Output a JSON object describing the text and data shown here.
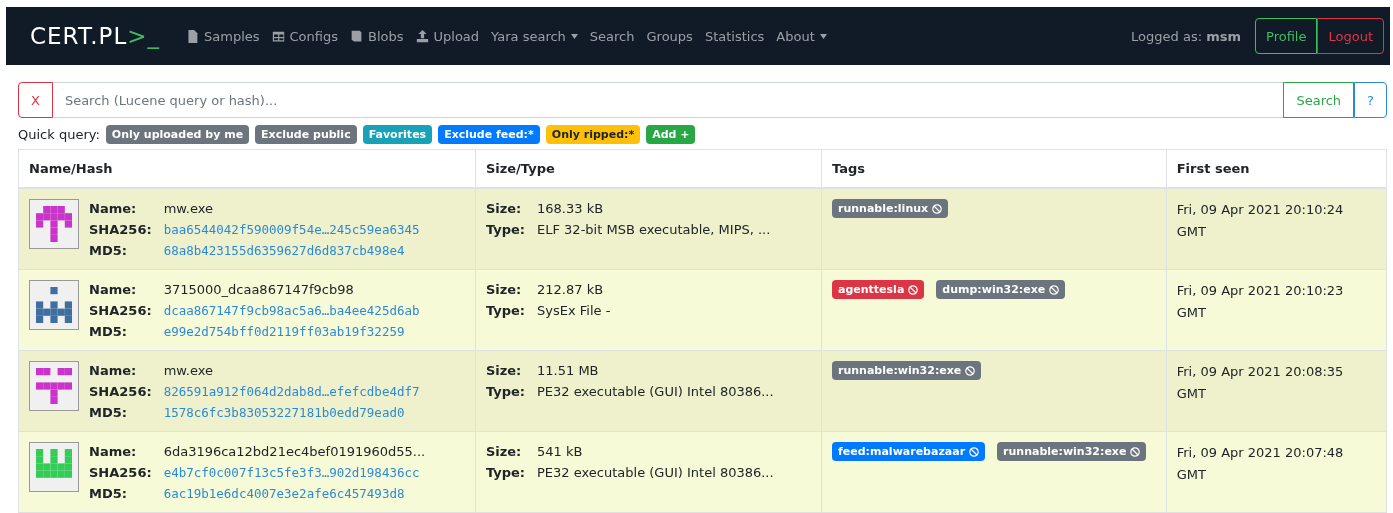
{
  "navbar": {
    "brand": {
      "text": "CERT.PL",
      "suffix": ">_"
    },
    "items": [
      {
        "label": "Samples",
        "dropdown": false
      },
      {
        "label": "Configs",
        "dropdown": false
      },
      {
        "label": "Blobs",
        "dropdown": false
      },
      {
        "label": "Upload",
        "dropdown": false
      },
      {
        "label": "Yara search",
        "dropdown": true
      },
      {
        "label": "Search",
        "dropdown": false
      },
      {
        "label": "Groups",
        "dropdown": false
      },
      {
        "label": "Statistics",
        "dropdown": false
      },
      {
        "label": "About",
        "dropdown": true
      }
    ],
    "user_label": "Logged as:",
    "user": "msm",
    "profile_button": "Profile",
    "logout_button": "Logout"
  },
  "search": {
    "clear_button": "X",
    "placeholder": "Search (Lucene query or hash)...",
    "search_button": "Search",
    "help_button": "?"
  },
  "quick_query": {
    "label": "Quick query:",
    "badges": [
      {
        "label": "Only uploaded by me",
        "color": "#6c757d"
      },
      {
        "label": "Exclude public",
        "color": "#6c757d"
      },
      {
        "label": "Favorites",
        "color": "#17a2b8"
      },
      {
        "label": "Exclude feed:*",
        "color": "#007bff"
      },
      {
        "label": "Only ripped:*",
        "color": "#ffc107"
      },
      {
        "label": "Add +",
        "color": "#28a745"
      }
    ]
  },
  "table": {
    "columns": [
      "Name/Hash",
      "Size/Type",
      "Tags",
      "First seen"
    ],
    "rows": [
      {
        "color": "#c934c9",
        "name": {
          "label": "Name:",
          "value": "mw.exe"
        },
        "sha256": {
          "label": "SHA256:",
          "value": "baa6544042f590009f54e…245c59ea6345"
        },
        "md5": {
          "label": "MD5:",
          "value": "68a8b423155d6359627d6d837cb498e4"
        },
        "size": {
          "label": "Size:",
          "value": "168.33 kB"
        },
        "type": {
          "label": "Type:",
          "value": "ELF 32-bit MSB executable, MIPS, ..."
        },
        "tags": [
          {
            "label": "runnable:linux",
            "color": "#6c757d"
          }
        ],
        "first_seen": "Fri, 09 Apr 2021 20:10:24 GMT"
      },
      {
        "color": "#3f6f9f",
        "name": {
          "label": "Name:",
          "value": "3715000_dcaa867147f9cb98"
        },
        "sha256": {
          "label": "SHA256:",
          "value": "dcaa867147f9cb98ac5a6…ba4ee425d6ab"
        },
        "md5": {
          "label": "MD5:",
          "value": "e99e2d754bff0d2119ff03ab19f32259"
        },
        "size": {
          "label": "Size:",
          "value": "212.87 kB"
        },
        "type": {
          "label": "Type:",
          "value": "SysEx File -"
        },
        "tags": [
          {
            "label": "agenttesla",
            "color": "#dc3545"
          },
          {
            "label": "dump:win32:exe",
            "color": "#6c757d"
          }
        ],
        "first_seen": "Fri, 09 Apr 2021 20:10:23 GMT"
      },
      {
        "color": "#cc33cc",
        "name": {
          "label": "Name:",
          "value": "mw.exe"
        },
        "sha256": {
          "label": "SHA256:",
          "value": "826591a912f064d2dab8d…efefcdbe4df7"
        },
        "md5": {
          "label": "MD5:",
          "value": "1578c6fc3b83053227181b0edd79ead0"
        },
        "size": {
          "label": "Size:",
          "value": "11.51 MB"
        },
        "type": {
          "label": "Type:",
          "value": "PE32 executable (GUI) Intel 80386..."
        },
        "tags": [
          {
            "label": "runnable:win32:exe",
            "color": "#6c757d"
          }
        ],
        "first_seen": "Fri, 09 Apr 2021 20:08:35 GMT"
      },
      {
        "color": "#33cc55",
        "name": {
          "label": "Name:",
          "value": "6da3196ca12bd21ec4bef0191960d55..."
        },
        "sha256": {
          "label": "SHA256:",
          "value": "e4b7cf0c007f13c5fe3f3…902d198436cc"
        },
        "md5": {
          "label": "MD5:",
          "value": "6ac19b1e6dc4007e3e2afe6c457493d8"
        },
        "size": {
          "label": "Size:",
          "value": "541 kB"
        },
        "type": {
          "label": "Type:",
          "value": "PE32 executable (GUI) Intel 80386..."
        },
        "tags": [
          {
            "label": "feed:malwarebazaar",
            "color": "#007bff"
          },
          {
            "label": "runnable:win32:exe",
            "color": "#6c757d"
          }
        ],
        "first_seen": "Fri, 09 Apr 2021 20:07:48 GMT"
      }
    ]
  }
}
